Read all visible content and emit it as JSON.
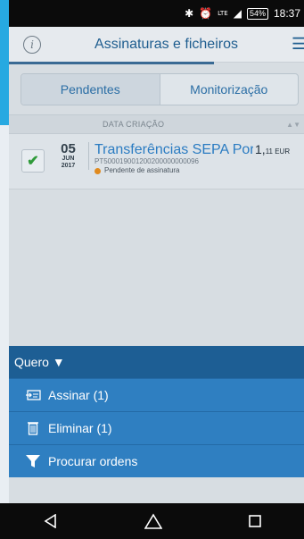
{
  "status_bar": {
    "icons": [
      "bluetooth-icon",
      "alarm-icon",
      "lte-icon",
      "signal-icon"
    ],
    "battery": "54%",
    "time": "18:37"
  },
  "header": {
    "title": "Assinaturas e ficheiros"
  },
  "tabs": [
    {
      "label": "Pendentes",
      "active": true
    },
    {
      "label": "Monitorização",
      "active": false
    }
  ],
  "list": {
    "column_header": "DATA CRIAÇÃO",
    "rows": [
      {
        "checked": true,
        "day": "05",
        "month": "JUN",
        "year": "2017",
        "title": "Transferências SEPA Por",
        "reference": "PT500019001200200000000096",
        "status": "Pendente de assinatura",
        "amount_main": "1,",
        "amount_cents": "11 EUR"
      }
    ]
  },
  "actions": {
    "header": "Quero",
    "items": [
      {
        "label": "Assinar (1)",
        "icon": "sign-icon"
      },
      {
        "label": "Eliminar (1)",
        "icon": "trash-icon"
      },
      {
        "label": "Procurar ordens",
        "icon": "filter-icon"
      }
    ]
  },
  "colors": {
    "accent": "#2b7cc2",
    "action_bg": "#2f7fc1",
    "action_header": "#1d5e94",
    "status_pending": "#e08a1e",
    "check": "#2f9a3a"
  }
}
